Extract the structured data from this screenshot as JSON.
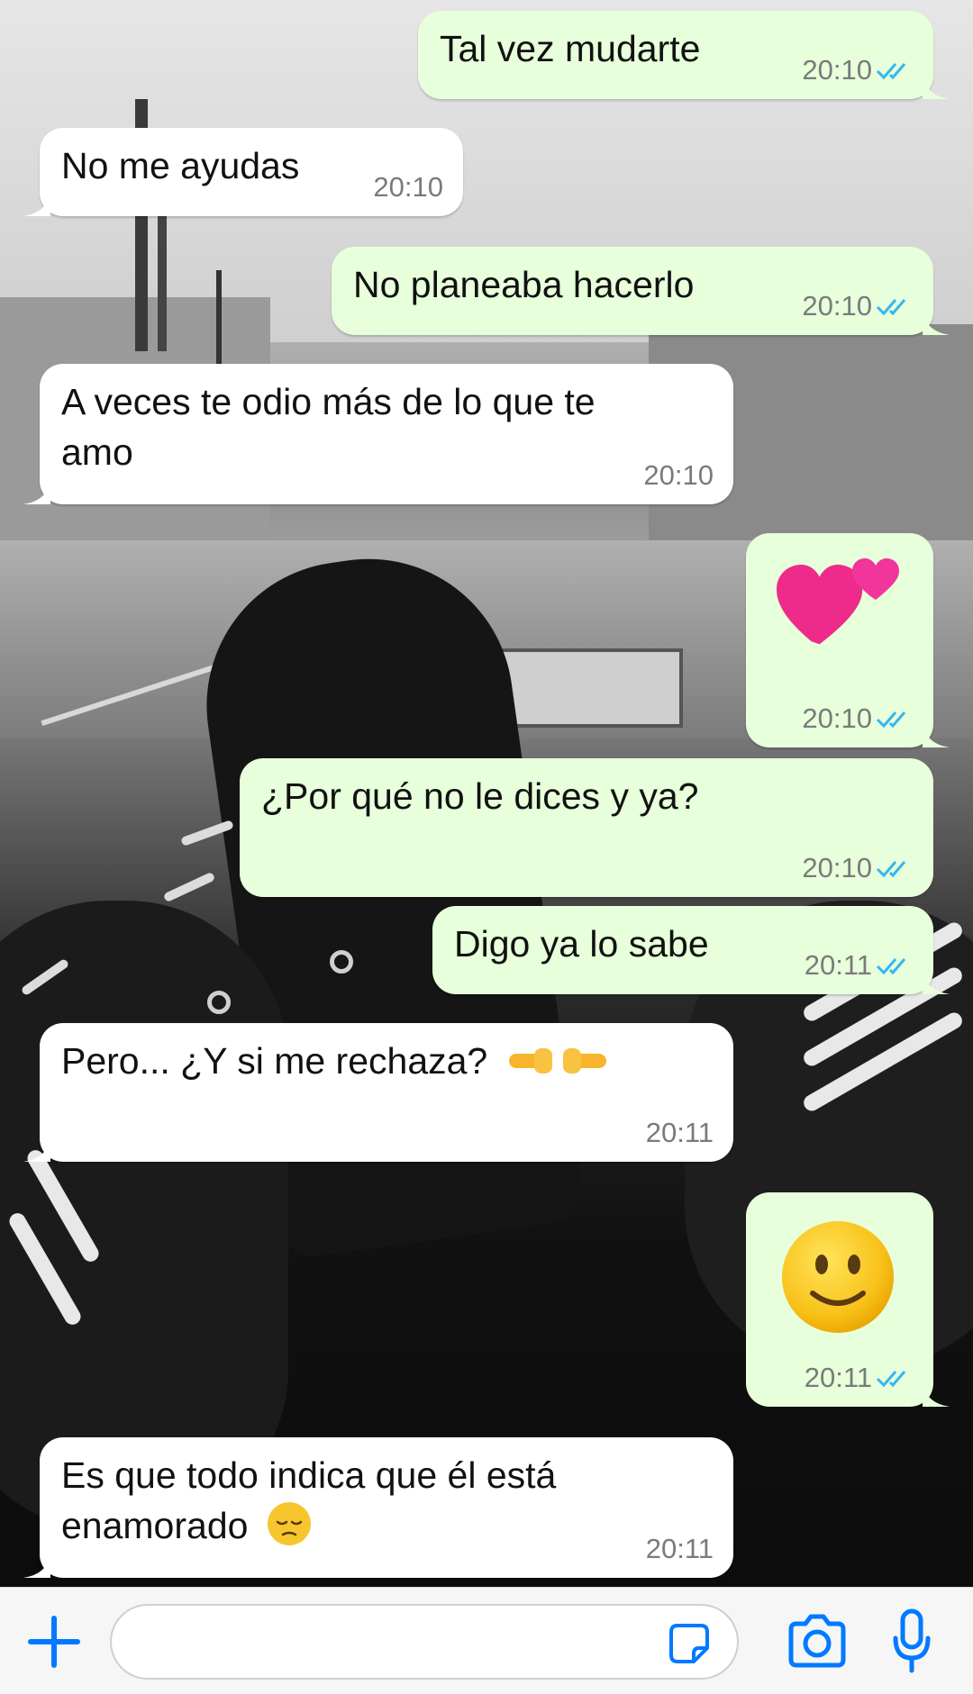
{
  "messages": [
    {
      "dir": "out",
      "text": "Tal vez mudarte",
      "time": "20:10",
      "status": "read"
    },
    {
      "dir": "in",
      "text": "No me ayudas",
      "time": "20:10"
    },
    {
      "dir": "out",
      "text": "No planeaba hacerlo",
      "time": "20:10",
      "status": "read"
    },
    {
      "dir": "in",
      "text": "A veces te odio más de lo que te amo",
      "time": "20:10"
    },
    {
      "dir": "out",
      "emoji": "two-hearts",
      "time": "20:10",
      "status": "read"
    },
    {
      "dir": "out",
      "text": "¿Por qué no le dices y ya?",
      "time": "20:10",
      "status": "read"
    },
    {
      "dir": "out",
      "text": "Digo ya lo sabe",
      "time": "20:11",
      "status": "read"
    },
    {
      "dir": "in",
      "text": "Pero... ¿Y si me rechaza?",
      "emoji": "index-pointing-fingers",
      "time": "20:11"
    },
    {
      "dir": "out",
      "emoji": "slightly-smiling-face",
      "time": "20:11",
      "status": "read"
    },
    {
      "dir": "in",
      "text": "Es que todo indica que él está enamorado",
      "emoji": "pensive-face",
      "time": "20:11"
    }
  ],
  "composer": {
    "input_value": "",
    "icons": [
      "plus-icon",
      "sticker-icon",
      "camera-icon",
      "microphone-icon"
    ]
  },
  "colors": {
    "outgoing_bubble": "#e7ffdb",
    "incoming_bubble": "#ffffff",
    "read_tick": "#34b7f1",
    "accent": "#007aff"
  }
}
